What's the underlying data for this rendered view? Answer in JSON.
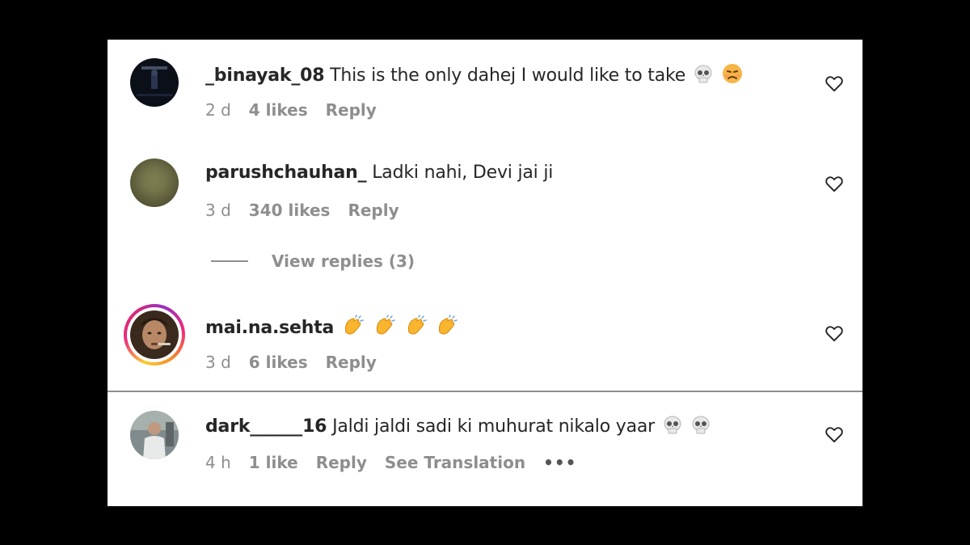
{
  "comments": [
    {
      "username": "_binayak_08",
      "text": "This is the only dahej I would like to take",
      "emojis": [
        "skull",
        "pouting-face"
      ],
      "time": "2 d",
      "likes": "4 likes",
      "reply": "Reply"
    },
    {
      "username": "parushchauhan_",
      "text": "Ladki nahi, Devi jai ji",
      "emojis": [],
      "time": "3 d",
      "likes": "340 likes",
      "reply": "Reply",
      "view_replies": "View replies (3)"
    },
    {
      "username": "mai.na.sehta",
      "text": "",
      "emojis": [
        "clapping-hands",
        "clapping-hands",
        "clapping-hands",
        "clapping-hands"
      ],
      "time": "3 d",
      "likes": "6 likes",
      "reply": "Reply",
      "has_story_ring": true
    },
    {
      "username": "dark______16",
      "text": "Jaldi jaldi sadi ki muhurat nikalo yaar",
      "emojis": [
        "skull",
        "skull"
      ],
      "time": "4 h",
      "likes": "1 like",
      "reply": "Reply",
      "see_translation": "See Translation",
      "more": "•••"
    }
  ],
  "colors": {
    "text": "#262626",
    "muted": "#8e8e8e",
    "background": "#ffffff",
    "frame": "#000000"
  },
  "icons": {
    "like": "heart-outline-icon"
  }
}
